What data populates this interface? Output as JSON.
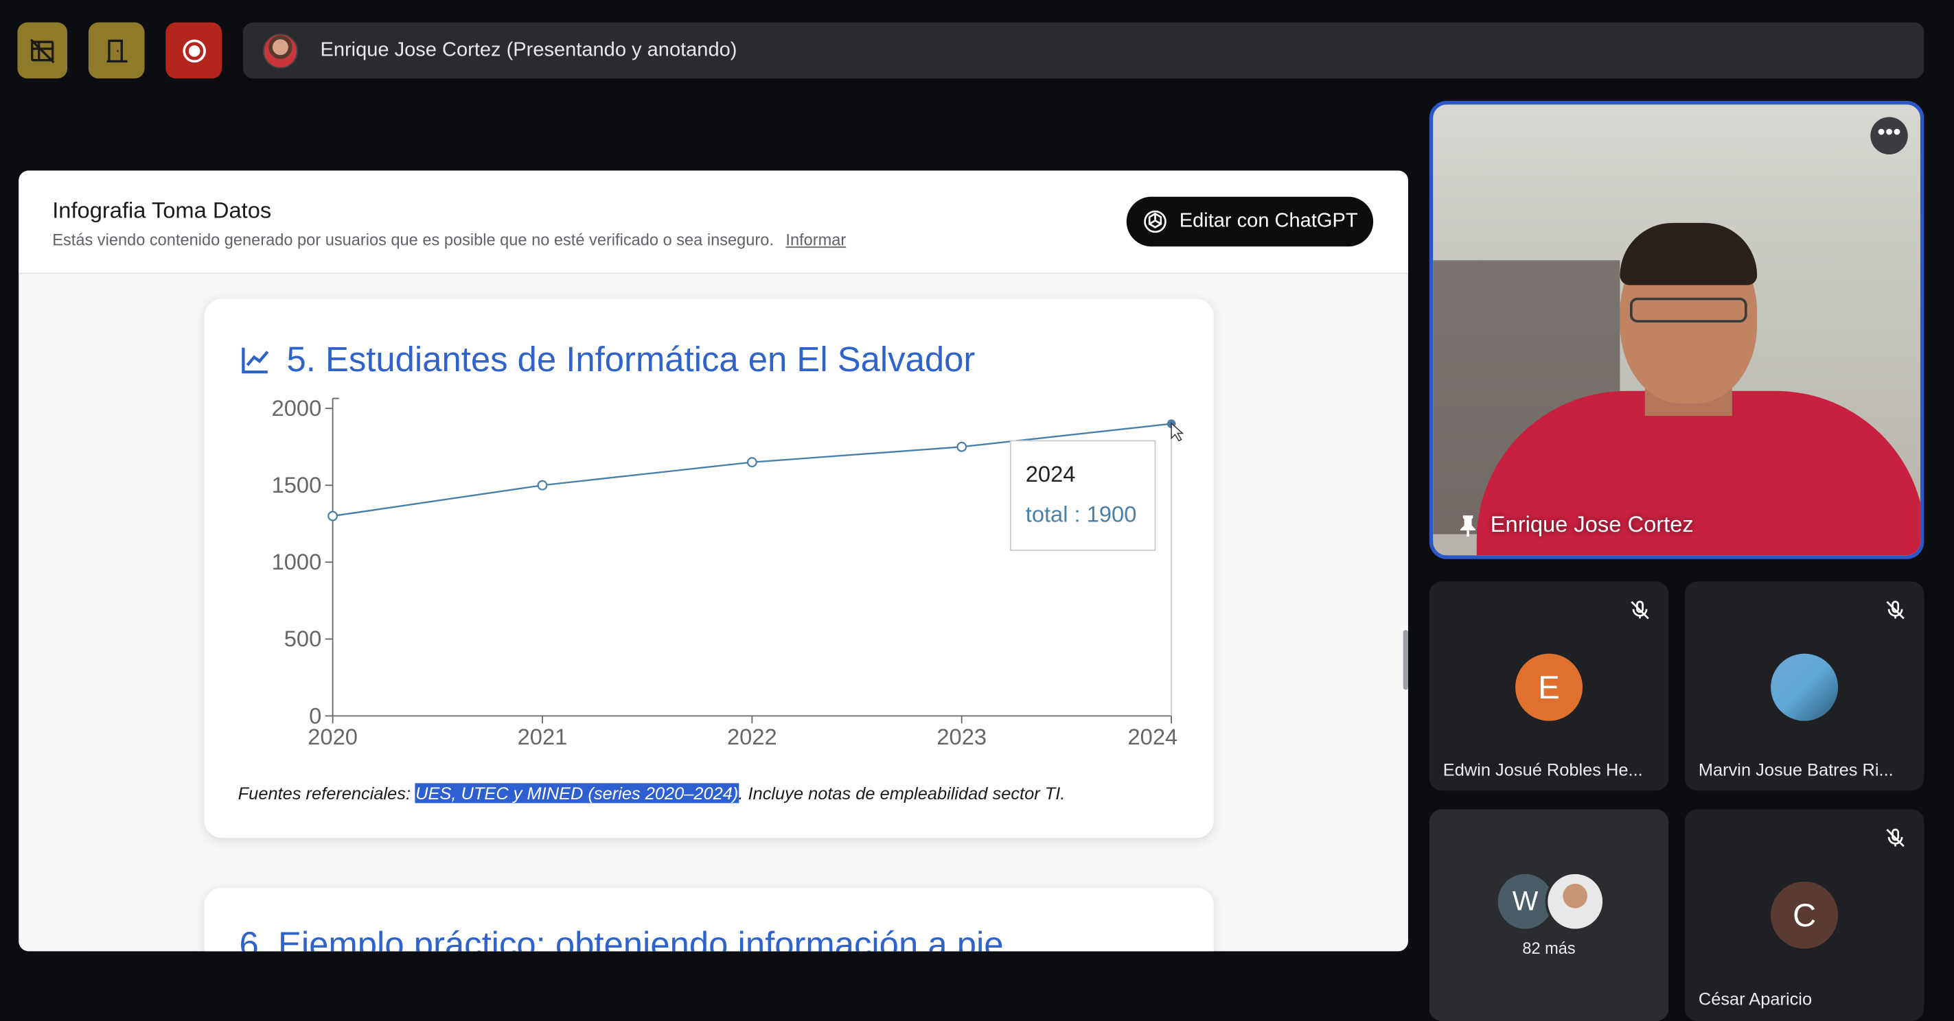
{
  "topbar": {
    "layout_icon": "layout-off-icon",
    "leave_icon": "door-icon",
    "record_icon": "record-icon",
    "presenter_text": "Enrique Jose Cortez (Presentando y anotando)"
  },
  "panel": {
    "title": "Infografia Toma Datos",
    "subtitle": "Estás viendo contenido generado por usuarios que es posible que no esté verificado o sea inseguro.",
    "report_link": "Informar",
    "chatgpt_button": "Editar con ChatGPT"
  },
  "card5": {
    "title": "5. Estudiantes de Informática en El Salvador",
    "sources_prefix": "Fuentes referenciales: ",
    "sources_highlight": "UES, UTEC y MINED (series 2020–2024)",
    "sources_suffix": ". Incluye notas de empleabilidad sector TI."
  },
  "card6": {
    "title": "6. Ejemplo práctico: obteniendo información a pie"
  },
  "chart_data": {
    "type": "line",
    "categories": [
      "2020",
      "2021",
      "2022",
      "2023",
      "2024"
    ],
    "series": [
      {
        "name": "total",
        "values": [
          1300,
          1500,
          1650,
          1750,
          1900
        ]
      }
    ],
    "yticks": [
      "0",
      "500",
      "1000",
      "1500",
      "2000"
    ],
    "ylim": [
      0,
      2000
    ],
    "grid": false,
    "line_color": "#4a7fa8",
    "tooltip": {
      "title": "2024",
      "label": "total : 1900"
    }
  },
  "participants": {
    "main": "Enrique Jose Cortez",
    "edwin": {
      "initial": "E",
      "name": "Edwin Josué Robles He..."
    },
    "marvin": {
      "name": "Marvin Josue Batres Ri..."
    },
    "more": {
      "initial": "W",
      "count_label": "82 más"
    },
    "cesar": {
      "initial": "C",
      "name": "César Aparicio"
    }
  },
  "colors": {
    "accent": "#2f63c9",
    "pin_border": "#2b58c6",
    "record": "#b3261e"
  }
}
